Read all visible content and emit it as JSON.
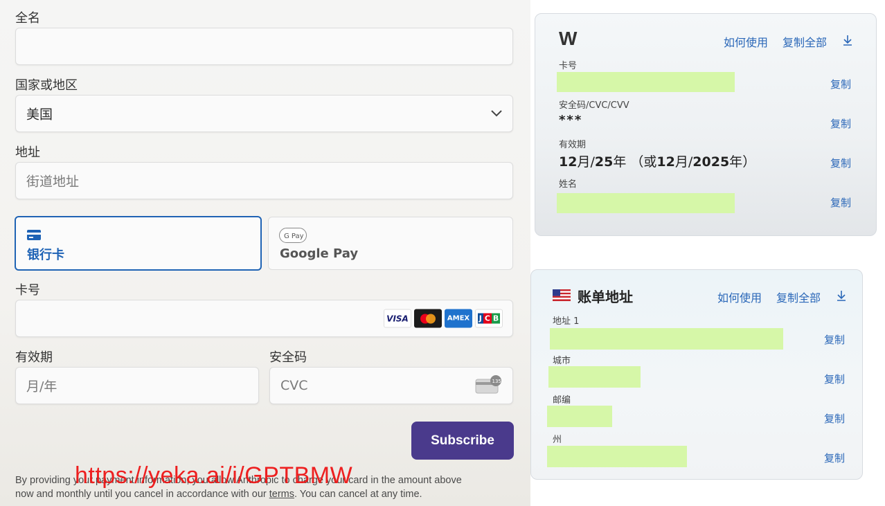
{
  "checkout": {
    "full_name": {
      "label": "全名",
      "value": ""
    },
    "country": {
      "label": "国家或地区",
      "value": "美国"
    },
    "address": {
      "label": "地址",
      "placeholder": "街道地址"
    },
    "payment_tabs": [
      {
        "label": "银行卡",
        "icon": "card-icon",
        "active": true
      },
      {
        "label": "Google Pay",
        "icon": "google-pay-icon",
        "active": false
      }
    ],
    "card_number": {
      "label": "卡号",
      "brands": [
        "VISA",
        "Mastercard",
        "AMEX",
        "JCB"
      ]
    },
    "expiry": {
      "label": "有效期",
      "placeholder": "月/年"
    },
    "cvc": {
      "label": "安全码",
      "placeholder": "CVC",
      "badge": "135"
    },
    "subscribe_label": "Subscribe",
    "legal": {
      "line1": "By providing your payment information, you allow Anthropic to charge your card in the amount above",
      "line2_pre": "now and monthly until you cancel in accordance with our ",
      "terms": "terms",
      "line2_post": ". You can cancel at any time."
    },
    "watermark": "https://yeka.ai/i/GPTBMW"
  },
  "card_panel": {
    "logo": "W",
    "how_to_use": "如何使用",
    "copy_all": "复制全部",
    "fields": [
      {
        "label": "卡号",
        "value": "",
        "copy": "复制"
      },
      {
        "label": "安全码/CVC/CVV",
        "value": "***",
        "copy": "复制"
      },
      {
        "label": "有效期",
        "value": "",
        "copy": "复制"
      },
      {
        "label": "姓名",
        "value": "",
        "copy": "复制"
      }
    ],
    "expiry_parts": {
      "m": "12",
      "m_unit": "月",
      "sep1": "/",
      "y": "25",
      "y_unit": "年",
      "alt_open": "（或",
      "m2": "12",
      "m2_unit": "月",
      "sep2": "/",
      "y2": "2025",
      "y2_unit": "年",
      "alt_close": "）"
    }
  },
  "billing_panel": {
    "title": "账单地址",
    "flag": "us-flag-icon",
    "how_to_use": "如何使用",
    "copy_all": "复制全部",
    "fields": [
      {
        "label": "地址 1",
        "copy": "复制"
      },
      {
        "label": "城市",
        "copy": "复制"
      },
      {
        "label": "邮编",
        "copy": "复制"
      },
      {
        "label": "州",
        "copy": "复制"
      }
    ]
  },
  "colors": {
    "accent_blue": "#1d62b5",
    "subscribe_bg": "#4a3a8c",
    "highlight_green": "#d6f7a8",
    "link_blue": "#2a67b8",
    "watermark_red": "#ee1616"
  }
}
